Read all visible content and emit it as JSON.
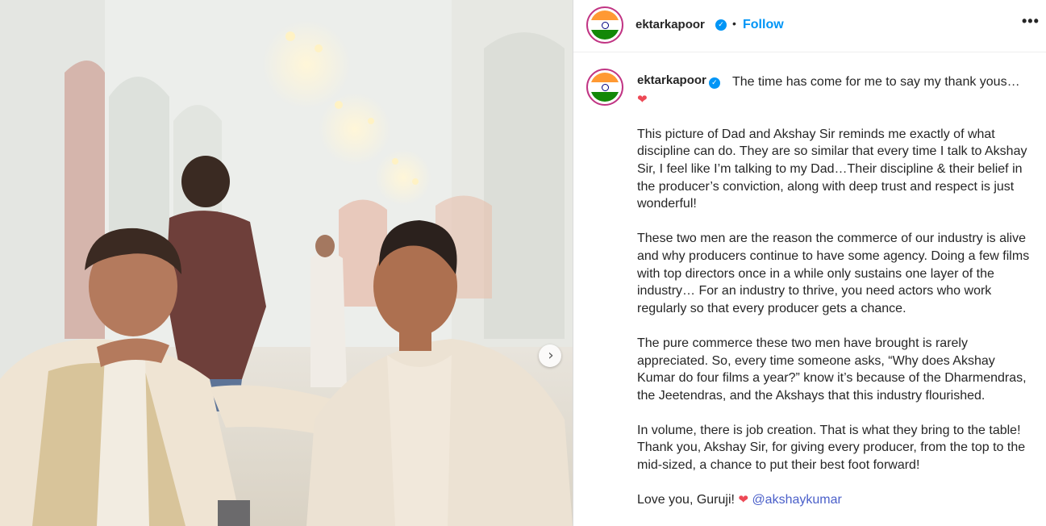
{
  "header": {
    "username": "ektarkapoor",
    "verified_icon": "verified-badge-icon",
    "separator": "•",
    "follow_label": "Follow",
    "more_label": "•••"
  },
  "caption": {
    "username": "ektarkapoor",
    "intro": "The time has come for me to say my thank yous…",
    "intro_emoji": "❤",
    "paragraphs": [
      "This picture of Dad and Akshay Sir reminds me exactly of what discipline can do. They are so similar that every time I talk to Akshay Sir, I feel like I’m talking to my Dad…Their discipline & their belief in the producer’s conviction, along with deep trust and respect is just wonderful!",
      "These two men are the reason the commerce of our industry is alive and why producers continue to have some agency. Doing a few films with top directors once in a while only sustains one layer of the industry… For an industry to thrive, you need actors who work regularly so that every producer gets a chance.",
      "The pure commerce these two men have brought is rarely appreciated. So, every time someone asks, “Why does Akshay Kumar do four films a year?” know it’s because of the Dharmendras, the Jeetendras, and the Akshays that this industry flourished.",
      "In volume, there is job creation. That is what they bring to the table! Thank you, Akshay Sir, for giving every producer, from the top to the mid-sized, a chance to put their best foot forward!"
    ],
    "closing": "Love you, Guruji!",
    "closing_emoji": "❤",
    "mention": "@akshaykumar"
  },
  "carousel": {
    "next_label": "›"
  },
  "colors": {
    "accent": "#0095f6",
    "text": "#262626",
    "heart": "#ed4956",
    "mention": "#4a5fc9",
    "flag_saffron": "#ff9933",
    "flag_green": "#138808"
  }
}
